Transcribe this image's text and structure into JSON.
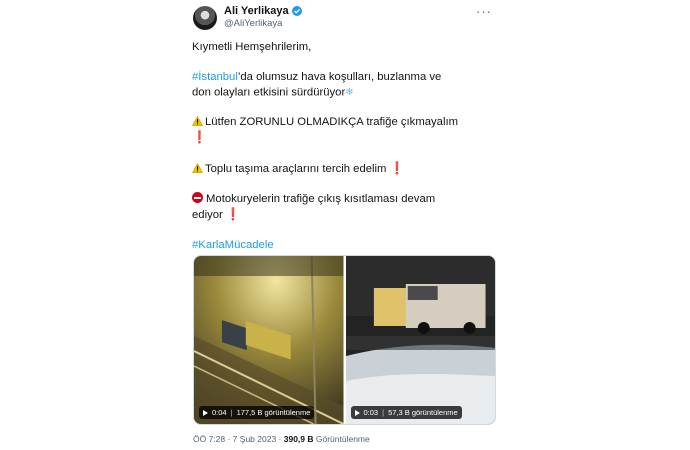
{
  "author": {
    "name": "Ali Yerlikaya",
    "handle": "@AliYerlikaya"
  },
  "tweet": {
    "greeting": "Kıymetli Hemşehrilerim,",
    "line1_hashtag": "#İstanbul",
    "line1_rest": "’da olumsuz hava koşulları, buzlanma ve",
    "line2": "don olayları etkisini sürdürüyor",
    "warning1": "Lütfen ZORUNLU OLMADIKÇA trafiğe çıkmayalım",
    "warning2": "Toplu taşıma araçlarını tercih edelim",
    "restriction_line1": "Motokuryelerin trafiğe çıkış kısıtlaması devam",
    "restriction_line2": "ediyor",
    "hashtag2": "#KarlaMücadele"
  },
  "media": [
    {
      "time": "0:04",
      "views": "177,5 B görüntülenme"
    },
    {
      "time": "0:03",
      "views": "57,3 B görüntülenme"
    }
  ],
  "meta": {
    "time_date": "ÖÖ 7:28 · 7 Şub 2023 · ",
    "views": "390,9 B",
    "views_label": " Görüntülenme"
  },
  "icons": {
    "more": "more-dots-icon",
    "verified": "verified-badge-icon",
    "play": "play-icon",
    "warning": "warning-icon",
    "exclamation": "exclamation-icon",
    "no_entry": "no-entry-icon",
    "snowflake": "snowflake-icon"
  },
  "colors": {
    "link": "#1d9bf0",
    "verified": "#1d9bf0",
    "secondary_text": "#536471",
    "alert_red": "#d0021b"
  }
}
